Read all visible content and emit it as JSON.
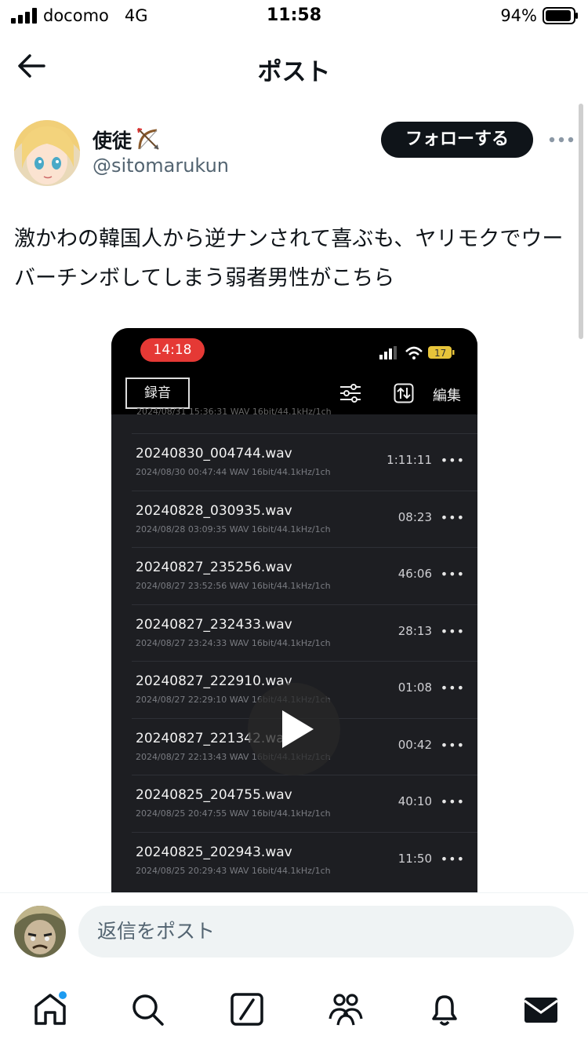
{
  "status_bar": {
    "carrier": "docomo",
    "network": "4G",
    "time": "11:58",
    "battery": "94%",
    "battery_level": 0.94
  },
  "header": {
    "title": "ポスト",
    "back_icon": "arrow-left-icon"
  },
  "post": {
    "author_name": "使徒",
    "author_emoji": "bow-and-arrow-emoji",
    "author_handle": "@sitomarukun",
    "follow_label": "フォローする",
    "more_icon": "more-horizontal-icon",
    "text": "激かわの韓国人から逆ナンされて喜ぶも、ヤリモクでウーバーチンボしてしまう弱者男性がこちら"
  },
  "media": {
    "type": "video",
    "phone_time": "14:18",
    "phone_battery": "17",
    "record_tab": "録音",
    "edit_label": "編集",
    "cut_row": "2024/08/31 15:36:31   WAV   16bit/44.1kHz/1ch",
    "recordings": [
      {
        "name": "20240830_004744.wav",
        "meta": "2024/08/30 00:47:44   WAV   16bit/44.1kHz/1ch",
        "duration": "1:11:11"
      },
      {
        "name": "20240828_030935.wav",
        "meta": "2024/08/28 03:09:35   WAV   16bit/44.1kHz/1ch",
        "duration": "08:23"
      },
      {
        "name": "20240827_235256.wav",
        "meta": "2024/08/27 23:52:56   WAV   16bit/44.1kHz/1ch",
        "duration": "46:06"
      },
      {
        "name": "20240827_232433.wav",
        "meta": "2024/08/27 23:24:33   WAV   16bit/44.1kHz/1ch",
        "duration": "28:13"
      },
      {
        "name": "20240827_222910.wav",
        "meta": "2024/08/27 22:29:10   WAV   16bit/44.1kHz/1ch",
        "duration": "01:08"
      },
      {
        "name": "20240827_221342.wav",
        "meta": "2024/08/27 22:13:43   WAV   16bit/44.1kHz/1ch",
        "duration": "00:42"
      },
      {
        "name": "20240825_204755.wav",
        "meta": "2024/08/25 20:47:55   WAV   16bit/44.1kHz/1ch",
        "duration": "40:10"
      },
      {
        "name": "20240825_202943.wav",
        "meta": "2024/08/25 20:29:43   WAV   16bit/44.1kHz/1ch",
        "duration": "11:50"
      }
    ],
    "row_more": "•••"
  },
  "reply": {
    "placeholder": "返信をポスト"
  },
  "nav": {
    "items": [
      "home-icon",
      "search-icon",
      "grok-icon",
      "communities-icon",
      "notifications-icon",
      "messages-icon"
    ],
    "accent_color": "#1d9bf0"
  }
}
